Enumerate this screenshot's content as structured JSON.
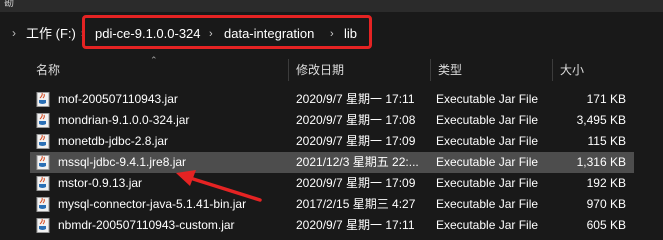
{
  "window": {
    "title": "勘"
  },
  "address": {
    "crumbs": [
      "工作 (F:)",
      "pdi-ce-9.1.0.0-324",
      "data-integration",
      "lib"
    ]
  },
  "columns": {
    "name": "名称",
    "modified": "修改日期",
    "type": "类型",
    "size": "大小"
  },
  "files": [
    {
      "name": "mof-200507110943.jar",
      "modified": "2020/9/7 星期一 17:11",
      "type": "Executable Jar File",
      "size": "171 KB"
    },
    {
      "name": "mondrian-9.1.0.0-324.jar",
      "modified": "2020/9/7 星期一 17:08",
      "type": "Executable Jar File",
      "size": "3,495 KB"
    },
    {
      "name": "monetdb-jdbc-2.8.jar",
      "modified": "2020/9/7 星期一 17:09",
      "type": "Executable Jar File",
      "size": "115 KB"
    },
    {
      "name": "mssql-jdbc-9.4.1.jre8.jar",
      "modified": "2021/12/3 星期五 22:...",
      "type": "Executable Jar File",
      "size": "1,316 KB"
    },
    {
      "name": "mstor-0.9.13.jar",
      "modified": "2020/9/7 星期一 17:09",
      "type": "Executable Jar File",
      "size": "192 KB"
    },
    {
      "name": "mysql-connector-java-5.1.41-bin.jar",
      "modified": "2017/2/15 星期三 4:27",
      "type": "Executable Jar File",
      "size": "970 KB"
    },
    {
      "name": "nbmdr-200507110943-custom.jar",
      "modified": "2020/9/7 星期一 17:11",
      "type": "Executable Jar File",
      "size": "605 KB"
    }
  ],
  "selected_index": 3,
  "colors": {
    "highlight": "#e52323",
    "selected_row": "#4d4d4d",
    "background": "#191919"
  }
}
